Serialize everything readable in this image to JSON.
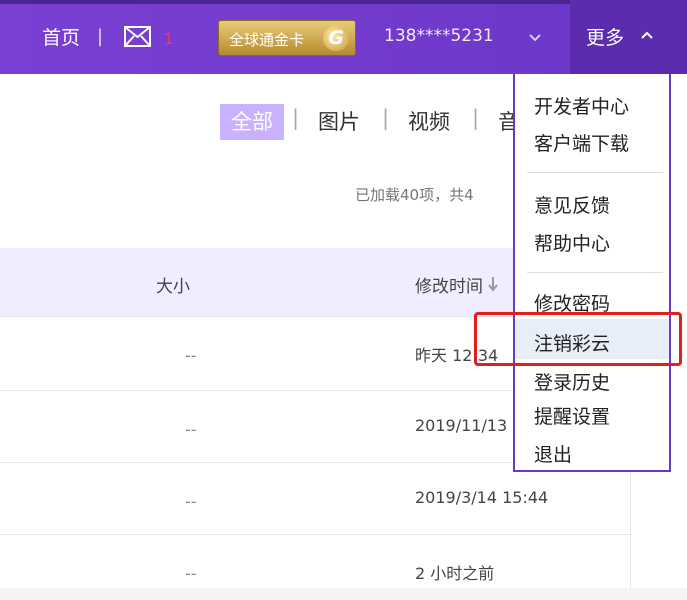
{
  "topbar": {
    "home": "首页",
    "separator": "|",
    "mail_badge": "1",
    "gold_card_label": "全球通金卡",
    "gold_card_logo": "G",
    "phone": "138****5231",
    "more": "更多"
  },
  "filters": {
    "all": "全部",
    "images": "图片",
    "videos": "视频",
    "music_partial": "音"
  },
  "status": {
    "loaded": "已加载40项，共4"
  },
  "table": {
    "headers": {
      "size": "大小",
      "modified": "修改时间"
    },
    "rows": [
      {
        "size": "--",
        "modified": "昨天 12:34"
      },
      {
        "size": "--",
        "modified": "2019/11/13"
      },
      {
        "size": "--",
        "modified": "2019/3/14 15:44"
      },
      {
        "size": "--",
        "modified": "2 小时之前"
      }
    ]
  },
  "more_menu": {
    "items": [
      "开发者中心",
      "客户端下载",
      "意见反馈",
      "帮助中心",
      "修改密码",
      "注销彩云",
      "登录历史",
      "提醒设置",
      "退出"
    ]
  },
  "colors": {
    "topbar": "#7a3fd3",
    "accent": "#c8b1ff",
    "highlight_box": "#e21e1e"
  }
}
